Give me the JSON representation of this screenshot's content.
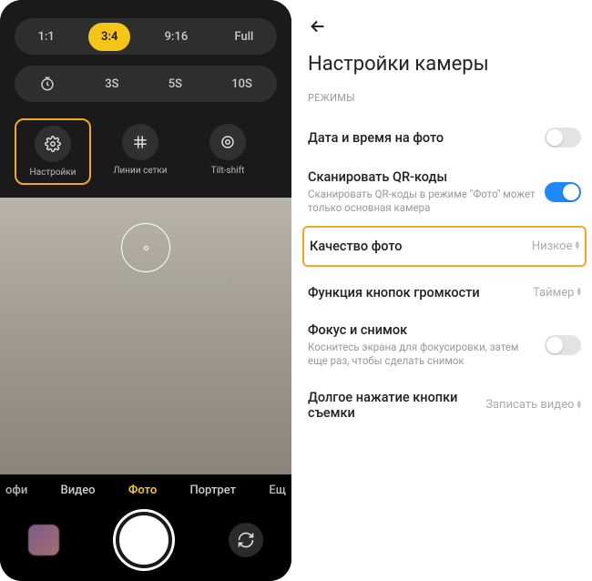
{
  "camera": {
    "ratios": [
      "1:1",
      "3:4",
      "9:16",
      "Full"
    ],
    "active_ratio": "3:4",
    "timer_options": [
      "3S",
      "5S",
      "10S"
    ],
    "tools": {
      "settings": "Настройки",
      "grid": "Линии сетки",
      "tilt": "Tilt-shift"
    },
    "modes": {
      "pro_cut": "офи",
      "video": "Видео",
      "photo": "Фото",
      "portrait": "Портрет",
      "more_cut": "Ещ"
    }
  },
  "settings": {
    "title": "Настройки камеры",
    "section": "РЕЖИМЫ",
    "date_time": "Дата и время на фото",
    "qr": "Сканировать QR-коды",
    "qr_sub": "Сканировать QR-коды в режиме \"Фото\" может только основная камера",
    "quality": "Качество фото",
    "quality_value": "Низкое",
    "volume_fn": "Функция кнопок громкости",
    "volume_value": "Таймер",
    "focus": "Фокус и снимок",
    "focus_sub": "Коснитесь экрана для фокусировки, затем еще раз, чтобы сделать снимок",
    "longpress": "Долгое нажатие кнопки съемки",
    "longpress_value": "Записать видео"
  }
}
